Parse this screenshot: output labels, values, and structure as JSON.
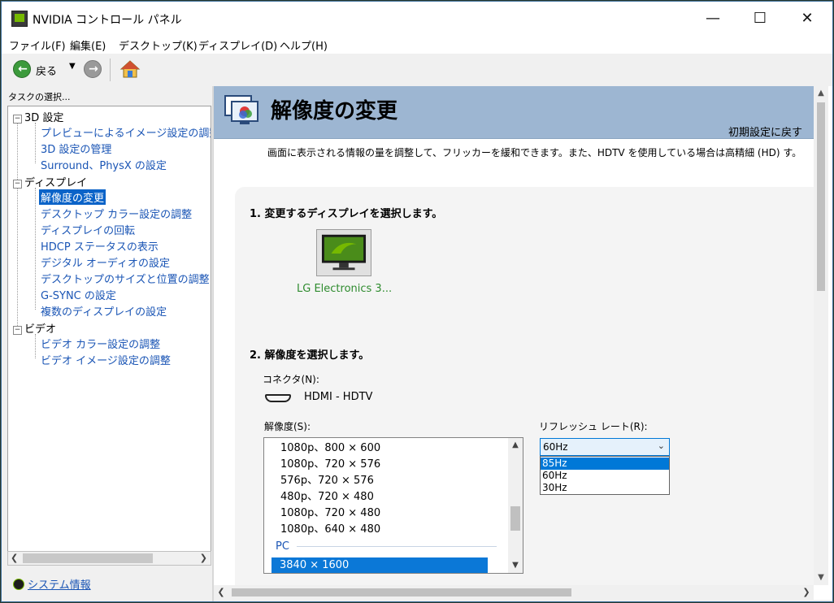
{
  "window": {
    "title": "NVIDIA コントロール パネル"
  },
  "menu": [
    "ファイル(F)",
    "編集(E)",
    "デスクトップ(K)",
    "ディスプレイ(D)",
    "ヘルプ(H)"
  ],
  "toolbar": {
    "back_label": "戻る"
  },
  "task_pane": {
    "label": "タスクの選択...",
    "groups": [
      {
        "label": "3D 設定",
        "items": [
          "プレビューによるイメージ設定の調整",
          "3D 設定の管理",
          "Surround、PhysX の設定"
        ]
      },
      {
        "label": "ディスプレイ",
        "items": [
          "解像度の変更",
          "デスクトップ カラー設定の調整",
          "ディスプレイの回転",
          "HDCP ステータスの表示",
          "デジタル オーディオの設定",
          "デスクトップのサイズと位置の調整",
          "G-SYNC の設定",
          "複数のディスプレイの設定"
        ]
      },
      {
        "label": "ビデオ",
        "items": [
          "ビデオ カラー設定の調整",
          "ビデオ イメージ設定の調整"
        ]
      }
    ],
    "system_info": "システム情報"
  },
  "page": {
    "title": "解像度の変更",
    "restore_defaults": "初期設定に戻す",
    "description": "画面に表示される情報の量を調整して、フリッカーを緩和できます。また、HDTV を使用している場合は高精細 (HD) す。",
    "step1": "1. 変更するディスプレイを選択します。",
    "display_name": "LG Electronics 3...",
    "step2": "2. 解像度を選択します。",
    "connector_label": "コネクタ(N):",
    "connector_value": "HDMI - HDTV",
    "resolution_label": "解像度(S):",
    "resolutions": [
      "1080p、800 × 600",
      "1080p、720 × 576",
      "576p、720 × 576",
      "480p、720 × 480",
      "1080p、720 × 480",
      "1080p、640 × 480"
    ],
    "resolution_group": "PC",
    "resolution_selected": "3840 × 1600",
    "refresh_label": "リフレッシュ レート(R):",
    "refresh_value": "60Hz",
    "refresh_options": [
      "85Hz",
      "60Hz",
      "30Hz"
    ]
  },
  "colors": {
    "accent": "#0078d7",
    "nvidia_green": "#76b900",
    "banner": "#9db6d2"
  }
}
